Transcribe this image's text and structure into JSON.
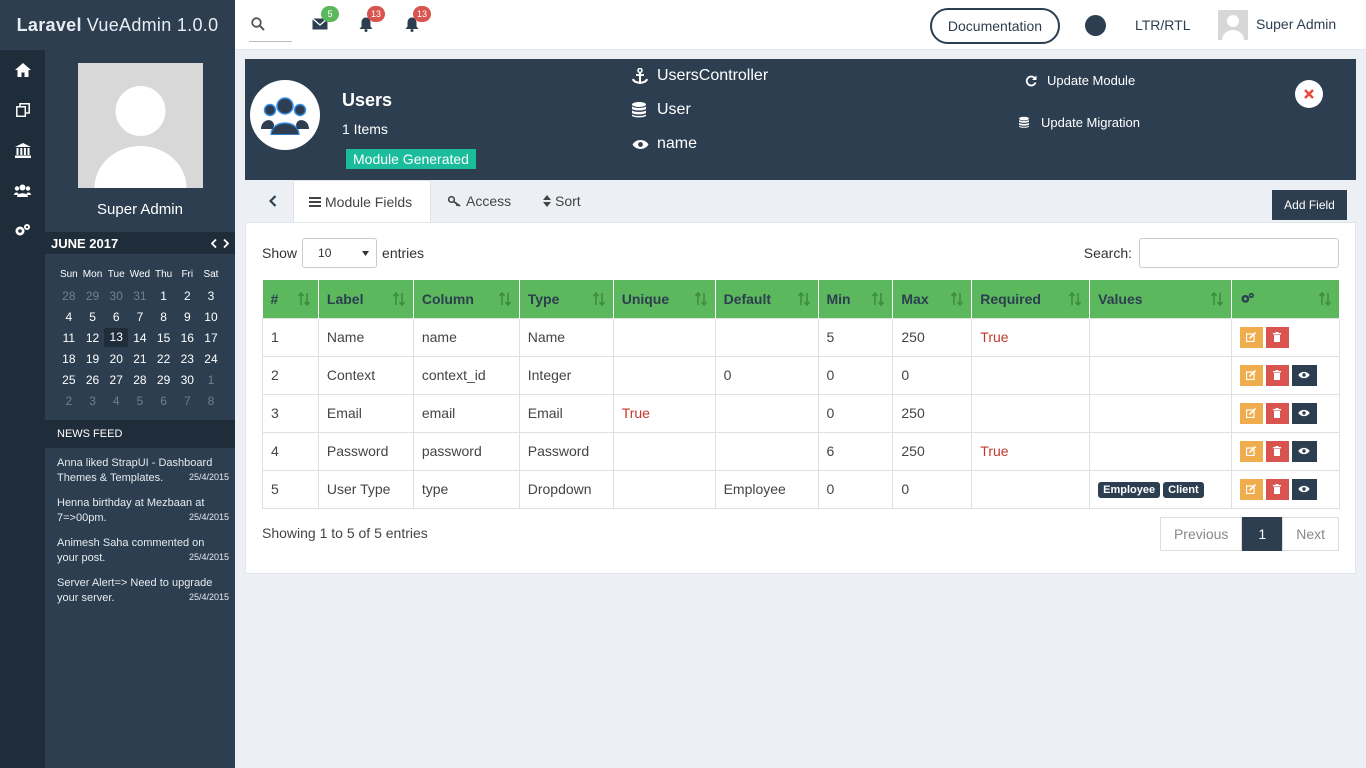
{
  "app": {
    "brand_bold": "Laravel",
    "brand_rest": "VueAdmin 1.0.0"
  },
  "topbar": {
    "mail_count": "5",
    "notif_count": "13",
    "alert_count": "13",
    "documentation": "Documentation",
    "ltr_rtl": "LTR/RTL",
    "user_name": "Super Admin"
  },
  "sidebar": {
    "profile_name": "Super Admin",
    "calendar": {
      "month": "JUNE 2017",
      "days": [
        "Sun",
        "Mon",
        "Tue",
        "Wed",
        "Thu",
        "Fri",
        "Sat"
      ],
      "weeks": [
        [
          "28",
          "29",
          "30",
          "31",
          "1",
          "2",
          "3"
        ],
        [
          "4",
          "5",
          "6",
          "7",
          "8",
          "9",
          "10"
        ],
        [
          "11",
          "12",
          "13",
          "14",
          "15",
          "16",
          "17"
        ],
        [
          "18",
          "19",
          "20",
          "21",
          "22",
          "23",
          "24"
        ],
        [
          "25",
          "26",
          "27",
          "28",
          "29",
          "30",
          "1"
        ],
        [
          "2",
          "3",
          "4",
          "5",
          "6",
          "7",
          "8"
        ]
      ]
    },
    "news_title": "NEWS FEED",
    "news": [
      {
        "text": "Anna liked StrapUI - Dashboard Themes & Templates.",
        "date": "25/4/2015"
      },
      {
        "text": "Henna birthday at Mezbaan at 7=>00pm.",
        "date": "25/4/2015"
      },
      {
        "text": "Animesh Saha commented on your post.",
        "date": "25/4/2015"
      },
      {
        "text": "Server Alert=> Need to upgrade your server.",
        "date": "25/4/2015"
      }
    ]
  },
  "module": {
    "name": "Users",
    "count": "1 Items",
    "status": "Module Generated",
    "controller": "UsersController",
    "model": "User",
    "view_col": "name",
    "update_module": "Update Module",
    "update_migration": "Update Migration"
  },
  "tabs": {
    "fields": "Module Fields",
    "access": "Access",
    "sort": "Sort",
    "add_field": "Add Field"
  },
  "table": {
    "show": "Show",
    "entries": "entries",
    "page_length": "10",
    "search_label": "Search:",
    "columns": [
      "#",
      "Label",
      "Column",
      "Type",
      "Unique",
      "Default",
      "Min",
      "Max",
      "Required",
      "Values"
    ],
    "rows": [
      {
        "n": "1",
        "label": "Name",
        "column": "name",
        "type": "Name",
        "unique": "",
        "default": "",
        "min": "5",
        "max": "250",
        "required": "True",
        "values": []
      },
      {
        "n": "2",
        "label": "Context",
        "column": "context_id",
        "type": "Integer",
        "unique": "",
        "default": "0",
        "min": "0",
        "max": "0",
        "required": "",
        "values": []
      },
      {
        "n": "3",
        "label": "Email",
        "column": "email",
        "type": "Email",
        "unique": "True",
        "default": "",
        "min": "0",
        "max": "250",
        "required": "",
        "values": []
      },
      {
        "n": "4",
        "label": "Password",
        "column": "password",
        "type": "Password",
        "unique": "",
        "default": "",
        "min": "6",
        "max": "250",
        "required": "True",
        "values": []
      },
      {
        "n": "5",
        "label": "User Type",
        "column": "type",
        "type": "Dropdown",
        "unique": "",
        "default": "Employee",
        "min": "0",
        "max": "0",
        "required": "",
        "values": [
          "Employee",
          "Client"
        ]
      }
    ],
    "info": "Showing 1 to 5 of 5 entries",
    "prev": "Previous",
    "page": "1",
    "next": "Next"
  },
  "colors": {
    "primary": "#2c3e50",
    "header_green": "#5cb85c",
    "teal": "#1abc9c",
    "edit": "#f0ad4e",
    "delete": "#d9534f"
  }
}
